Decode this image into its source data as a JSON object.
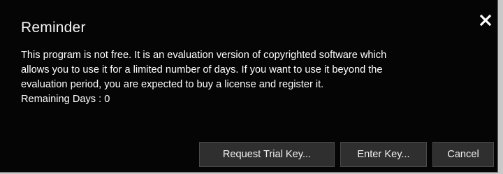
{
  "dialog": {
    "title": "Reminder",
    "message_lines": [
      "This program is not free. It is an evaluation version of copyrighted software which",
      "allows you to use it for a limited number of days. If you want to use it beyond the",
      "evaluation period, you are expected to buy a license and register it.",
      "Remaining Days : 0"
    ],
    "close_icon": "close-x-icon",
    "buttons": {
      "request_trial_key": "Request Trial Key...",
      "enter_key": "Enter Key...",
      "cancel": "Cancel"
    }
  },
  "colors": {
    "dialog_background": "#050505",
    "text": "#ffffff",
    "button_background": "#2f2f2f",
    "page_background": "#c9c9c9"
  }
}
